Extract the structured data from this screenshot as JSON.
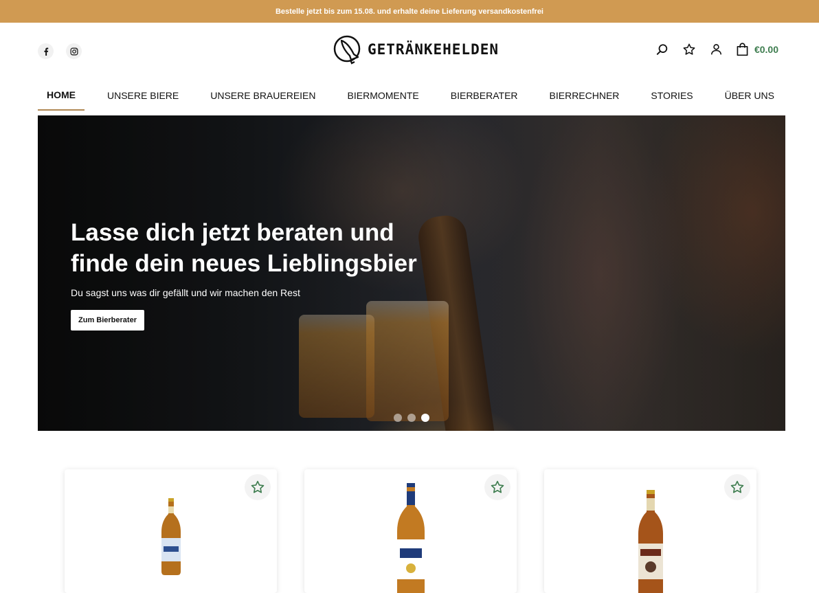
{
  "promo": {
    "text": "Bestelle jetzt bis zum 15.08. und erhalte deine Lieferung versandkostenfrei"
  },
  "header": {
    "logo_text": "GETRÄNKEHELDEN",
    "social": [
      {
        "icon": "facebook-icon"
      },
      {
        "icon": "instagram-icon"
      }
    ],
    "actions": {
      "search_icon": "search-icon",
      "wishlist_icon": "star-icon",
      "account_icon": "user-icon",
      "cart_icon": "shopping-bag-icon",
      "cart_total": "€0.00"
    }
  },
  "nav": {
    "items": [
      {
        "label": "HOME",
        "active": true
      },
      {
        "label": "UNSERE BIERE"
      },
      {
        "label": "UNSERE BRAUEREIEN"
      },
      {
        "label": "BIERMOMENTE"
      },
      {
        "label": "BIERBERATER"
      },
      {
        "label": "BIERRECHNER"
      },
      {
        "label": "STORIES"
      },
      {
        "label": "ÜBER UNS"
      }
    ]
  },
  "hero": {
    "title": "Lasse dich jetzt beraten und finde dein neues Lieblingsbier",
    "subtitle": "Du sagst uns was dir gefällt und wir machen den Rest",
    "cta_label": "Zum Bierberater",
    "slides_total": 3,
    "active_slide": 3
  },
  "products": [
    {
      "wishlist_icon": "star-outline-icon",
      "bottle_label_color": "#d9e4f2"
    },
    {
      "wishlist_icon": "star-outline-icon",
      "bottle_label_color": "#ffffff"
    },
    {
      "wishlist_icon": "star-outline-icon",
      "bottle_label_color": "#ece4d4"
    }
  ],
  "colors": {
    "promo_bg": "#d09a52",
    "accent_green": "#3e7d4f",
    "nav_underline": "#b08752"
  }
}
